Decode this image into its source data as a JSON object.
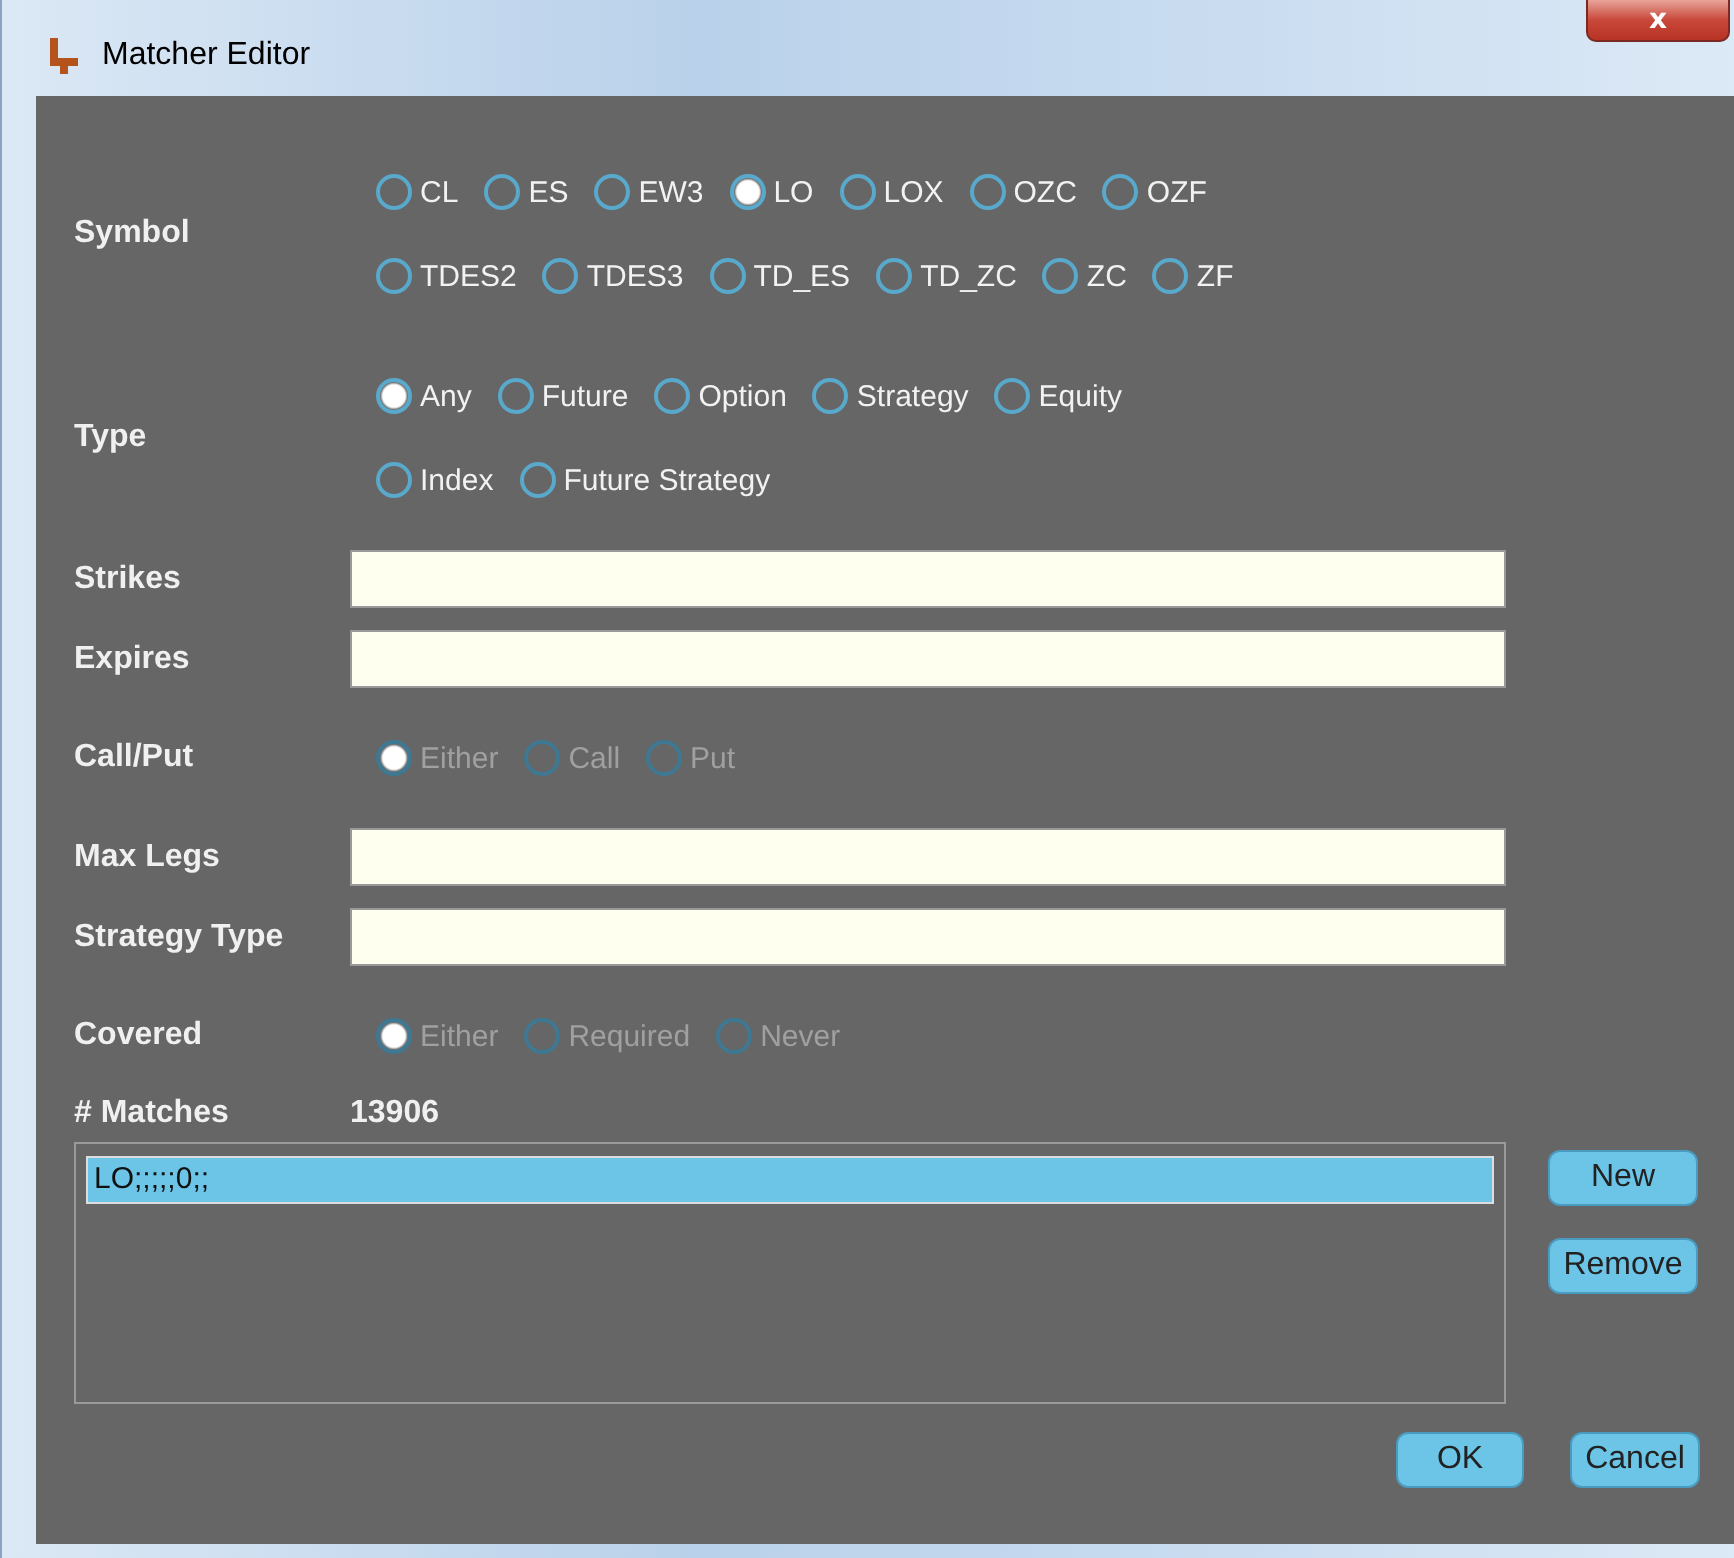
{
  "window": {
    "title": "Matcher Editor",
    "close": "x"
  },
  "sections": [
    {
      "kind": "radio",
      "label": "Symbol",
      "disabled": false,
      "options": [
        {
          "label": "CL",
          "selected": false
        },
        {
          "label": "ES",
          "selected": false
        },
        {
          "label": "EW3",
          "selected": false
        },
        {
          "label": "LO",
          "selected": true
        },
        {
          "label": "LOX",
          "selected": false
        },
        {
          "label": "OZC",
          "selected": false
        },
        {
          "label": "OZF",
          "selected": false
        },
        {
          "label": "TDES2",
          "selected": false
        },
        {
          "label": "TDES3",
          "selected": false
        },
        {
          "label": "TD_ES",
          "selected": false
        },
        {
          "label": "TD_ZC",
          "selected": false
        },
        {
          "label": "ZC",
          "selected": false
        },
        {
          "label": "ZF",
          "selected": false
        }
      ]
    },
    {
      "kind": "radio",
      "label": "Type",
      "disabled": false,
      "options": [
        {
          "label": "Any",
          "selected": true
        },
        {
          "label": "Future",
          "selected": false
        },
        {
          "label": "Option",
          "selected": false
        },
        {
          "label": "Strategy",
          "selected": false
        },
        {
          "label": "Equity",
          "selected": false
        },
        {
          "label": "Index",
          "selected": false
        },
        {
          "label": "Future Strategy",
          "selected": false
        }
      ]
    },
    {
      "kind": "field",
      "label": "Strikes"
    },
    {
      "kind": "field",
      "label": "Expires"
    },
    {
      "kind": "radio",
      "label": "Call/Put",
      "disabled": true,
      "options": [
        {
          "label": "Either",
          "selected": true
        },
        {
          "label": "Call",
          "selected": false
        },
        {
          "label": "Put",
          "selected": false
        }
      ]
    },
    {
      "kind": "field",
      "label": "Max Legs"
    },
    {
      "kind": "field",
      "label": "Strategy Type"
    },
    {
      "kind": "radio",
      "label": "Covered",
      "disabled": true,
      "options": [
        {
          "label": "Either",
          "selected": true
        },
        {
          "label": "Required",
          "selected": false
        },
        {
          "label": "Never",
          "selected": false
        }
      ]
    },
    {
      "kind": "value",
      "label": "# Matches",
      "value": "13906"
    }
  ],
  "list": {
    "items": [
      {
        "text": "LO;;;;;0;;",
        "selected": true
      }
    ],
    "buttons": [
      "New",
      "Remove"
    ]
  },
  "footer_buttons": [
    "OK",
    "Cancel"
  ]
}
